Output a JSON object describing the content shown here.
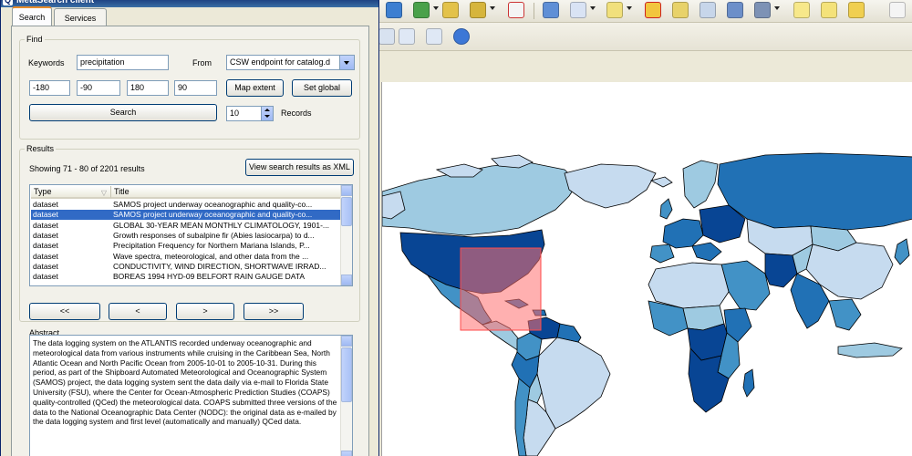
{
  "dialog": {
    "title": "MetaSearch client",
    "app_icon": "Q",
    "tabs": [
      {
        "label": "Search",
        "active": true
      },
      {
        "label": "Services",
        "active": false
      }
    ]
  },
  "find": {
    "group_title": "Find",
    "keywords_label": "Keywords",
    "keywords_value": "precipitation",
    "from_label": "From",
    "from_value": "CSW endpoint for catalog.d",
    "bbox": {
      "minx": "-180",
      "miny": "-90",
      "maxx": "180",
      "maxy": "90"
    },
    "map_extent_label": "Map extent",
    "set_global_label": "Set global",
    "search_label": "Search",
    "records_value": "10",
    "records_label": "Records"
  },
  "results": {
    "group_title": "Results",
    "summary": "Showing 71 - 80 of 2201 results",
    "view_xml_label": "View search results as XML",
    "columns": [
      "Type",
      "Title"
    ],
    "rows": [
      {
        "type": "dataset",
        "title": "SAMOS project underway oceanographic and quality-co..."
      },
      {
        "type": "dataset",
        "title": "SAMOS project underway oceanographic and quality-co...",
        "selected": true
      },
      {
        "type": "dataset",
        "title": "GLOBAL 30-YEAR MEAN MONTHLY CLIMATOLOGY, 1901-..."
      },
      {
        "type": "dataset",
        "title": "Growth responses of subalpine fir (Abies lasiocarpa) to d..."
      },
      {
        "type": "dataset",
        "title": "Precipitation Frequency for Northern Mariana Islands, P..."
      },
      {
        "type": "dataset",
        "title": "Wave spectra, meteorological, and other data from the ..."
      },
      {
        "type": "dataset",
        "title": "CONDUCTIVITY, WIND DIRECTION, SHORTWAVE IRRAD..."
      },
      {
        "type": "dataset",
        "title": "BOREAS 1994 HYD-09 BELFORT RAIN GAUGE DATA"
      }
    ],
    "nav": {
      "first": "<<",
      "prev": "<",
      "next": ">",
      "last": ">>"
    }
  },
  "abstract": {
    "label": "Abstract",
    "text": "The data logging system on the ATLANTIS recorded underway oceanographic and meteorological data from various instruments while cruising in the Caribbean Sea, North Atlantic Ocean and North Pacific Ocean from 2005-10-01 to 2005-10-31. During this period, as part of the Shipboard Automated Meteorological and Oceanographic System (SAMOS) project, the data logging system sent the data daily via e-mail to Florida State University (FSU), where the Center for Ocean-Atmospheric Prediction Studies (COAPS) quality-controlled (QCed) the meteorological data. COAPS submitted three versions of the data to the National Oceanographic Data Center (NODC): the original data as e-mailed by the data logging system and first level (automatically and manually) QCed data."
  },
  "map": {
    "ocean_color": "#ffffff",
    "selection_box_color": "#ff7070",
    "choropleth_colors": [
      "#f0f6fc",
      "#c6dbef",
      "#9ecae1",
      "#4292c6",
      "#2171b5",
      "#084594"
    ]
  },
  "toolbar": {
    "icons": [
      "add-vector-icon",
      "add-raster-icon",
      "digitize-icon",
      "edit-icon",
      "delete-icon",
      "identify-icon",
      "zoom-icon",
      "select-icon",
      "filter-icon",
      "table-icon",
      "calculator-icon",
      "stats-icon",
      "annotation-icon",
      "help-icon"
    ],
    "nav_icons": [
      "zoom-last-icon",
      "zoom-next-icon",
      "refresh-icon"
    ]
  }
}
